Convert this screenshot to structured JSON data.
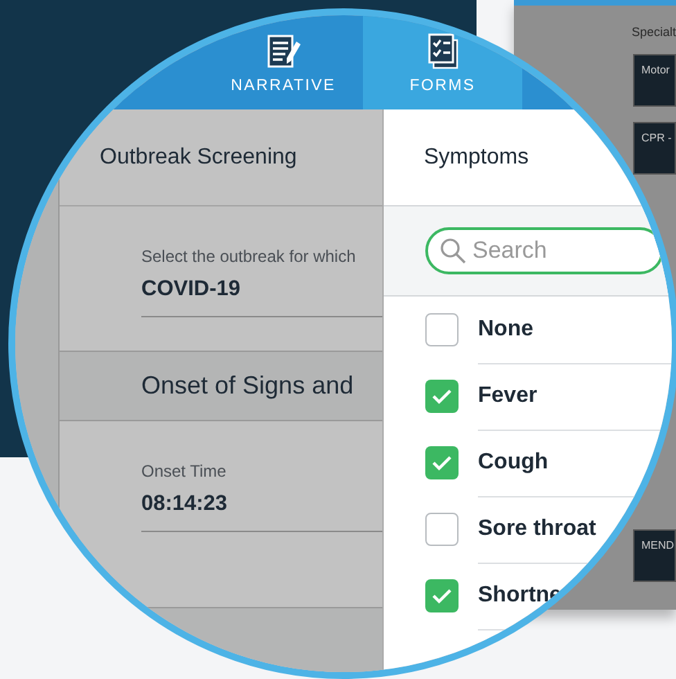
{
  "background_panel": {
    "heading": "Specialt",
    "tiles": [
      {
        "label": "Motor"
      },
      {
        "label": "CPR -"
      },
      {
        "label": "MEND"
      }
    ]
  },
  "nav_tabs": [
    {
      "label": "NARRATIVE",
      "selected": false,
      "kind": "narrative"
    },
    {
      "label": "FORMS",
      "selected": true,
      "kind": "forms"
    }
  ],
  "left_panel": {
    "title": "Outbreak Screening",
    "items": [
      {
        "kind": "field",
        "label": "Select the outbreak for which",
        "value": "COVID-19"
      },
      {
        "kind": "section",
        "title": "Onset of Signs and"
      },
      {
        "kind": "field",
        "label": "Onset Time",
        "value": "08:14:23"
      },
      {
        "kind": "section"
      }
    ]
  },
  "right_panel": {
    "title": "Symptoms",
    "search": {
      "placeholder": "Search"
    },
    "options": [
      {
        "label": "None",
        "checked": false
      },
      {
        "label": "Fever",
        "checked": true
      },
      {
        "label": "Cough",
        "checked": true
      },
      {
        "label": "Sore throat",
        "checked": false
      },
      {
        "label": "Shortne",
        "checked": true
      }
    ]
  }
}
